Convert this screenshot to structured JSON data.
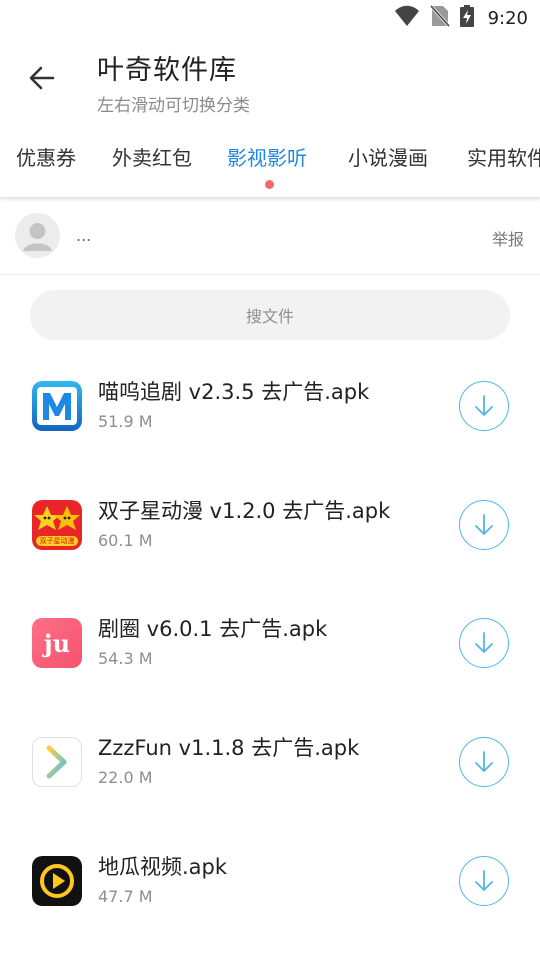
{
  "status_bar": {
    "time": "9:20"
  },
  "header": {
    "title": "叶奇软件库",
    "subtitle": "左右滑动可切换分类"
  },
  "tabs": [
    {
      "label": "优惠券"
    },
    {
      "label": "外卖红包"
    },
    {
      "label": "影视影听",
      "active": true
    },
    {
      "label": "小说漫画"
    },
    {
      "label": "实用软件"
    }
  ],
  "user": {
    "name": "...",
    "report_label": "举报"
  },
  "search": {
    "placeholder": "搜文件"
  },
  "files": [
    {
      "name": "喵呜追剧 v2.3.5 去广告.apk",
      "size": "51.9 M",
      "icon": "m-app-icon"
    },
    {
      "name": "双子星动漫 v1.2.0 去广告.apk",
      "size": "60.1 M",
      "icon": "twin-star-icon",
      "icon_caption": "双子星动漫"
    },
    {
      "name": "剧圈 v6.0.1 去广告.apk",
      "size": "54.3 M",
      "icon": "ju-app-icon",
      "icon_text": "ju"
    },
    {
      "name": "ZzzFun v1.1.8 去广告.apk",
      "size": "22.0 M",
      "icon": "zzzfun-icon"
    },
    {
      "name": "地瓜视频.apk",
      "size": "47.7 M",
      "icon": "digua-play-icon"
    }
  ],
  "colors": {
    "accent": "#1e88e5",
    "dot": "#f26a6a",
    "download": "#52b7e8"
  }
}
